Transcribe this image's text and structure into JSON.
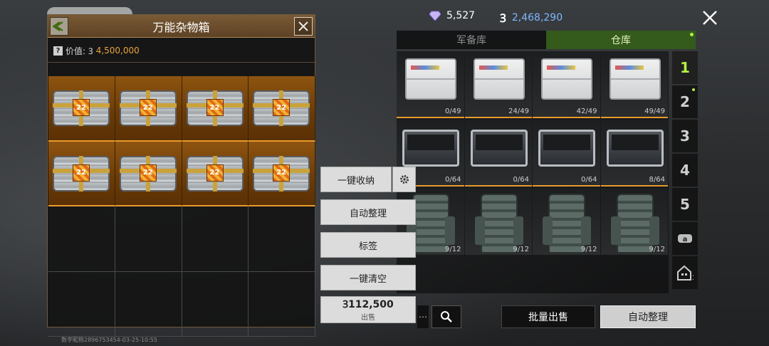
{
  "currency": {
    "gems": "5,527",
    "coin_symbol": "Ꝫ",
    "coins": "2,468,290"
  },
  "panel": {
    "title": "万能杂物箱",
    "value_label": "价值:",
    "value_coin_symbol": "Ꝫ",
    "value_amount": "4,500,000",
    "chest_level": "22"
  },
  "tabs": [
    {
      "label": "军备库"
    },
    {
      "label": "仓库"
    }
  ],
  "warehouse": {
    "items": [
      {
        "count": "0/49"
      },
      {
        "count": "24/49"
      },
      {
        "count": "42/49"
      },
      {
        "count": "49/49"
      },
      {
        "count": "0/64"
      },
      {
        "count": "0/64"
      },
      {
        "count": "0/64"
      },
      {
        "count": "8/64"
      },
      {
        "count": "9/12"
      },
      {
        "count": "9/12"
      },
      {
        "count": "9/12"
      },
      {
        "count": "9/12"
      }
    ]
  },
  "pages": [
    "1",
    "2",
    "3",
    "4",
    "5"
  ],
  "actions": {
    "stow_all": "一键收纳",
    "auto_sort": "自动整理",
    "tags": "标签",
    "clear_all": "一键清空",
    "sell_amount": "Ꝫ112,500",
    "sell_label": "出售"
  },
  "bottom": {
    "batch_sell": "批量出售",
    "auto_sort": "自动整理"
  },
  "watermark": "数字昵称2896753454-03-25-10:55",
  "colors": {
    "accent_green": "#b4f043",
    "orange": "#e89a2c",
    "coin_blue": "#7fb6ff"
  }
}
